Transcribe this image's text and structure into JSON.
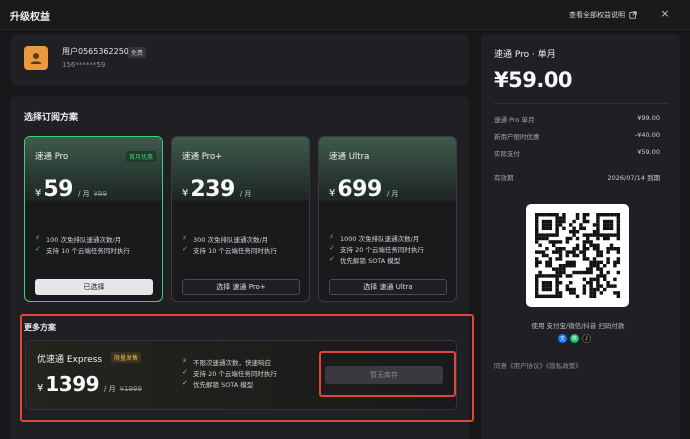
{
  "header": {
    "title": "升级权益",
    "rights_link": "查看全部权益说明",
    "close": "×"
  },
  "user": {
    "name": "用户0565362250",
    "badge": "免费",
    "phone": "156******59"
  },
  "plans_heading": "选择订阅方案",
  "plans": [
    {
      "name": "速通 Pro",
      "tag": "首月优惠",
      "currency": "¥",
      "price": "59",
      "per": "/ 月",
      "original": "¥99",
      "features": [
        "100 次免排队速通次数/月",
        "支持 10 个云端任务同时执行"
      ],
      "button": "已选择",
      "selected": true
    },
    {
      "name": "速通 Pro+",
      "tag": "",
      "currency": "¥",
      "price": "239",
      "per": "/ 月",
      "original": "",
      "features": [
        "300 次免排队速通次数/月",
        "支持 10 个云端任务同时执行"
      ],
      "button": "选择 速通 Pro+",
      "selected": false
    },
    {
      "name": "速通 Ultra",
      "tag": "",
      "currency": "¥",
      "price": "699",
      "per": "/ 月",
      "original": "",
      "features": [
        "1000 次免排队速通次数/月",
        "支持 20 个云端任务同时执行",
        "优先解锁 SOTA 模型"
      ],
      "button": "选择 速通 Ultra",
      "selected": false
    }
  ],
  "more_heading": "更多方案",
  "express": {
    "name": "优速通 Express",
    "tag": "限量发售",
    "currency": "¥",
    "price": "1399",
    "per": "/ 月",
    "original": "¥1999",
    "features": [
      "不限次速通次数，快速响应",
      "支持 20 个云端任务同时执行",
      "优先解锁 SOTA 模型"
    ],
    "button": "暂无库存"
  },
  "order": {
    "title": "速通 Pro · 单月",
    "price": "¥59.00",
    "lines": [
      {
        "label": "速通 Pro 单月",
        "value": "¥99.00"
      },
      {
        "label": "新用户限时优惠",
        "value": "-¥40.00"
      },
      {
        "label": "实际支付",
        "value": "¥59.00"
      },
      {
        "label": "有效期",
        "value": "2026/07/14 到期"
      }
    ],
    "pay_text": "使用 支付宝/微信/抖音 扫码付款",
    "pay_icons": [
      "alipay-icon",
      "wechat-icon",
      "douyin-icon"
    ],
    "agree": "同意《用户协议》《隐私政策》"
  },
  "colors": {
    "accent_green": "#3ecf7a",
    "gold": "#e3b84a",
    "highlight_red": "#e0463b"
  }
}
